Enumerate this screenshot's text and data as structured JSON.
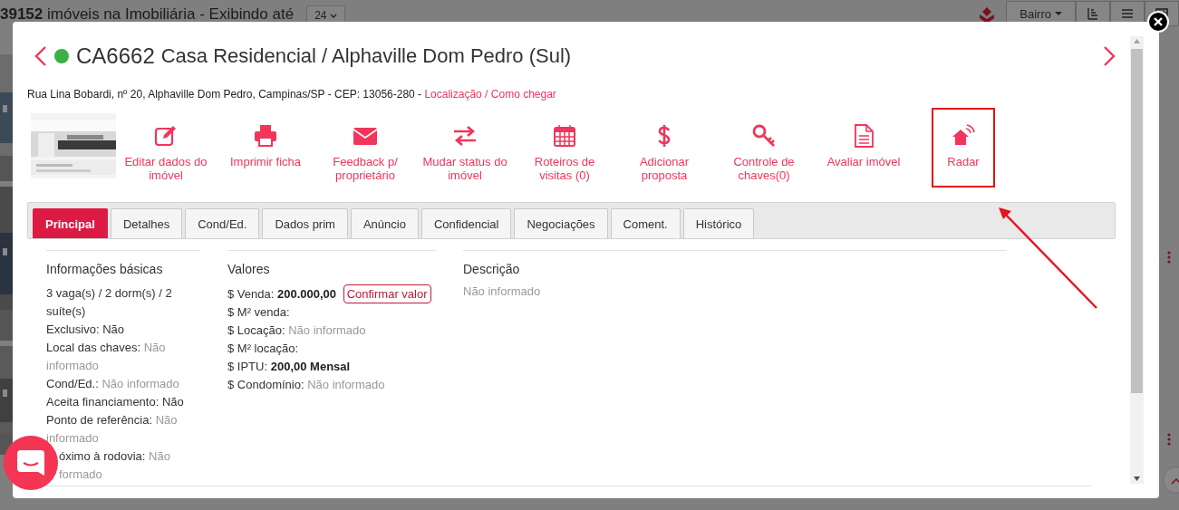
{
  "background": {
    "result_text": "**39152** imóveis na Imobiliária - Exibindo até",
    "page_size": "24",
    "sort_button": "Bairro"
  },
  "modal": {
    "code": "CA6662",
    "title": "Casa Residencial / Alphaville Dom Pedro (Sul)",
    "address": "Rua Lina Bobardi, nº 20, Alphaville Dom Pedro, Campinas/SP - CEP: 13056-280 -",
    "links": [
      "Localização",
      "Como chegar"
    ],
    "link_separator": "/",
    "actions": [
      {
        "kind": "edit",
        "label": "Editar dados do imóvel",
        "highlighted": false
      },
      {
        "kind": "print",
        "label": "Imprimir ficha",
        "highlighted": false
      },
      {
        "kind": "mail",
        "label": "Feedback p/ proprietário",
        "highlighted": false
      },
      {
        "kind": "swap",
        "label": "Mudar status do imóvel",
        "highlighted": false
      },
      {
        "kind": "calendar",
        "label": "Roteiros de visitas (0)",
        "highlighted": false
      },
      {
        "kind": "dollar",
        "label": "Adicionar proposta",
        "highlighted": false
      },
      {
        "kind": "key",
        "label": "Controle de chaves(0)",
        "highlighted": false
      },
      {
        "kind": "document",
        "label": "Avaliar imóvel",
        "highlighted": false
      },
      {
        "kind": "radar",
        "label": "Radar",
        "highlighted": true
      }
    ],
    "tabs": [
      {
        "label": "Principal",
        "selected": true
      },
      {
        "label": "Detalhes",
        "selected": false
      },
      {
        "label": "Cond/Ed.",
        "selected": false
      },
      {
        "label": "Dados prim",
        "selected": false
      },
      {
        "label": "Anúncio",
        "selected": false
      },
      {
        "label": "Confidencial",
        "selected": false
      },
      {
        "label": "Negociações",
        "selected": false
      },
      {
        "label": "Coment.",
        "selected": false
      },
      {
        "label": "Histórico",
        "selected": false
      }
    ],
    "basic_info": {
      "heading": "Informações básicas",
      "rows": [
        {
          "label": "3 vaga(s) / 2 dorm(s) / 2 suíte(s)"
        },
        {
          "label": "Exclusivo:",
          "value": "Não",
          "muted": false
        },
        {
          "label": "Local das chaves:",
          "value": "Não informado",
          "muted": true
        },
        {
          "label": "Cond/Ed.:",
          "value": "Não informado",
          "muted": true
        },
        {
          "label": "Aceita financiamento:",
          "value": "Não",
          "muted": false
        },
        {
          "label": "Ponto de referência:",
          "value": "Não informado",
          "muted": true
        },
        {
          "label": "óximo à rodovia:",
          "value": "Não formado",
          "muted": true,
          "partly_hidden": true
        }
      ]
    },
    "values": {
      "heading": "Valores",
      "rows": [
        {
          "label": "$ Venda:",
          "value": "200.000,00",
          "muted": false,
          "button": "Confirmar valor"
        },
        {
          "label": "$ M² venda:"
        },
        {
          "label": "$ Locação:",
          "value": "Não informado",
          "muted": true
        },
        {
          "label": "$ M² locação:"
        },
        {
          "label": "$ IPTU:",
          "value": "200,00 Mensal",
          "muted": false
        },
        {
          "label": "$ Condomínio:",
          "value": "Não informado",
          "muted": true
        }
      ]
    },
    "description": {
      "heading": "Descrição",
      "text": "Não informado"
    }
  }
}
